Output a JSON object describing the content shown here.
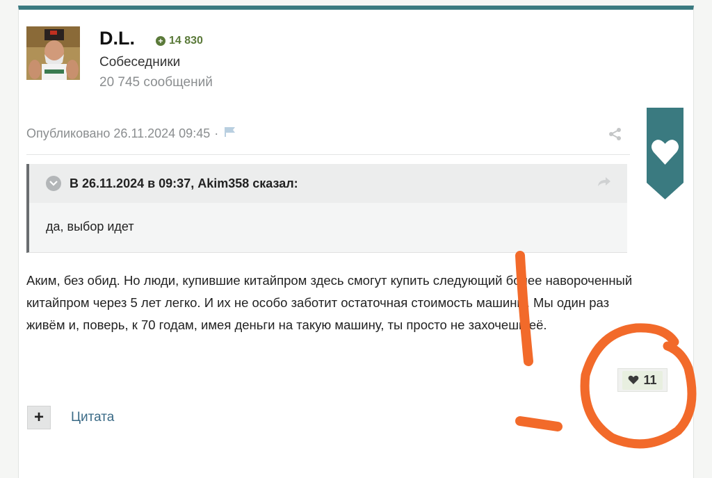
{
  "author": {
    "name": "D.L.",
    "reputation": "14 830",
    "group": "Собеседники",
    "posts": "20 745 сообщений"
  },
  "post": {
    "published": "Опубликовано 26.11.2024 09:45",
    "separator": "·",
    "quote": {
      "citation": "В 26.11.2024 в 09:37, Akim358 сказал:",
      "text": "да, выбор идет"
    },
    "content": "Аким, без обид. Но люди, купившие китайпром здесь смогут купить следующий более навороченный китайпром через 5 лет легко. И их не особо заботит остаточная стоимость машины. Мы один раз живём и, поверь, к 70 годам, имея деньги на такую машину, ты просто не захочешь её.",
    "reaction_count": "11"
  },
  "actions": {
    "multiquote": "+",
    "quote": "Цитата"
  },
  "colors": {
    "accent": "#3a7a80",
    "reputation": "#5b7a3a",
    "link": "#3a6a86",
    "annotation": "#f26a2a"
  },
  "icons": [
    "flag-icon",
    "share-icon",
    "heart-icon",
    "chevron-down-icon",
    "goto-arrow-icon"
  ]
}
